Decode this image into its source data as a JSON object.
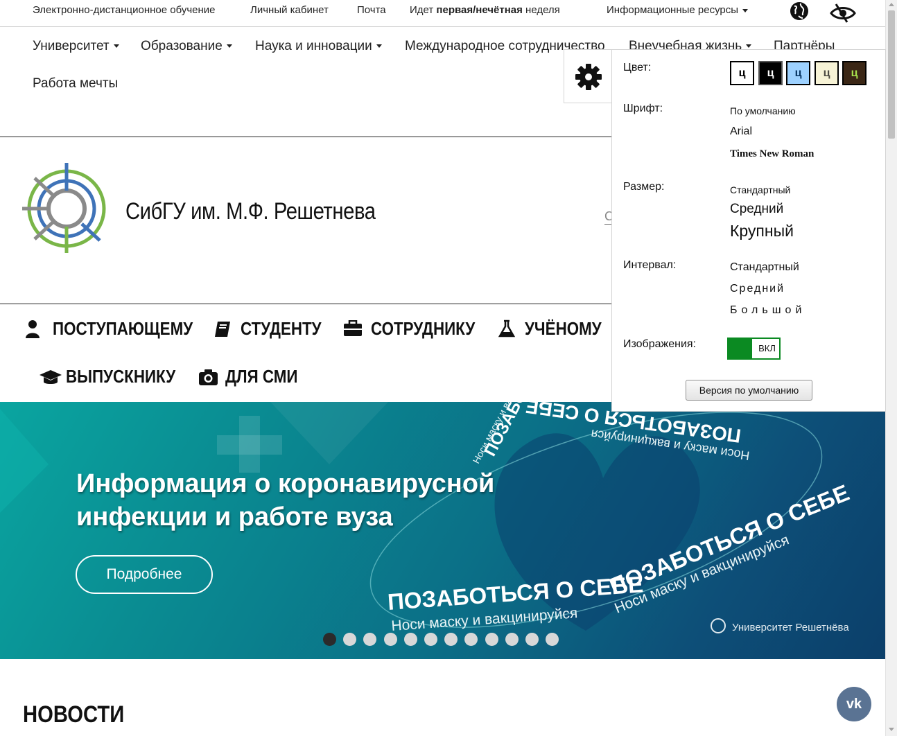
{
  "topbar": {
    "distance_learning": "Электронно-дистанционное обучение",
    "cabinet": "Личный кабинет",
    "mail": "Почта",
    "week_prefix": "Идет",
    "week_bold": "первая/нечётная",
    "week_suffix": "неделя",
    "resources": "Информационные ресурсы"
  },
  "mainnav": {
    "university": "Университет",
    "education": "Образование",
    "science": "Наука и инновации",
    "international": "Международное сотрудничество",
    "extracurricular": "Внеучебная жизнь",
    "partners": "Партнёры",
    "dream_job": "Работа мечты"
  },
  "header": {
    "brand": "СибГУ им. М.Ф. Решетнева",
    "search_stub": "С"
  },
  "audience": {
    "applicant": "ПОСТУПАЮЩЕМУ",
    "student": "СТУДЕНТУ",
    "employee": "СОТРУДНИКУ",
    "scientist": "УЧЁНОМУ",
    "graduate": "ВЫПУСКНИКУ",
    "media": "ДЛЯ СМИ"
  },
  "banner": {
    "title_line1": "Информация о коронавирусной",
    "title_line2": "инфекции и работе вуза",
    "button": "Подробнее",
    "art_main": "ПОЗАБОТЬСЯ О СЕБЕ",
    "art_sub": "Носи маску и вакцинируйся",
    "art_brand": "Университет Решетнёва",
    "slides_total": 12,
    "slide_active": 1
  },
  "news": {
    "title": "НОВОСТИ"
  },
  "vk": {
    "label": "vk"
  },
  "accessibility": {
    "color_label": "Цвет:",
    "swatch_letter": "ц",
    "swatches": [
      {
        "bg": "#ffffff",
        "fg": "#000000"
      },
      {
        "bg": "#000000",
        "fg": "#ffffff"
      },
      {
        "bg": "#9dd1ff",
        "fg": "#063462"
      },
      {
        "bg": "#f7f3d6",
        "fg": "#4d4b43"
      },
      {
        "bg": "#3b2716",
        "fg": "#a9e44d"
      }
    ],
    "font_label": "Шрифт:",
    "font_default": "По умолчанию",
    "font_arial": "Arial",
    "font_times": "Times New Roman",
    "size_label": "Размер:",
    "size_standard": "Стандартный",
    "size_medium": "Средний",
    "size_large": "Крупный",
    "interval_label": "Интервал:",
    "interval_standard": "Стандартный",
    "interval_medium": "Средний",
    "interval_large": "Большой",
    "images_label": "Изображения:",
    "images_toggle": "ВКЛ",
    "images_on": true,
    "reset": "Версия по умолчанию",
    "accent": "#0b8a22"
  }
}
